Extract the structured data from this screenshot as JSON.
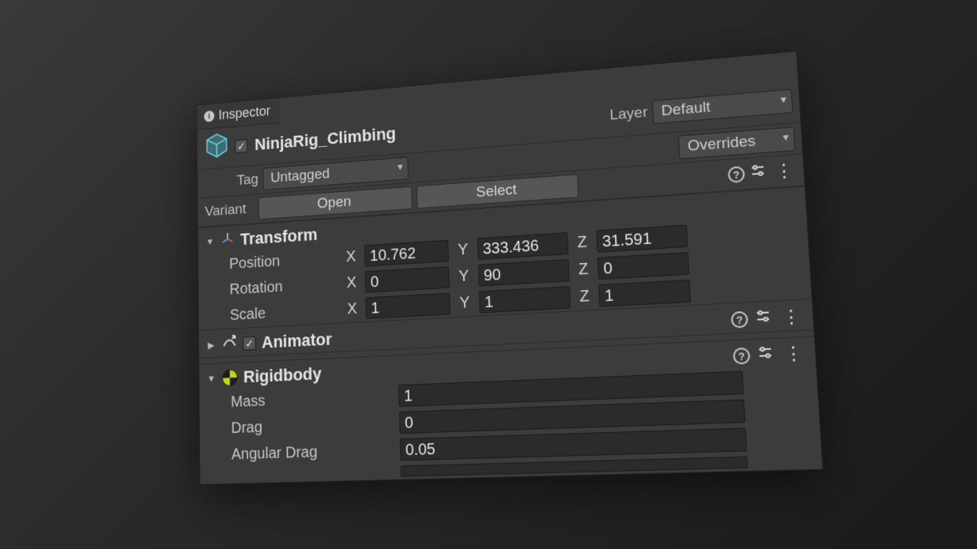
{
  "inspector": {
    "tab_label": "Inspector",
    "object": {
      "enabled_check": "✓",
      "name": "NinjaRig_Climbing"
    },
    "tag_label": "Tag",
    "tag_value": "Untagged",
    "layer_label": "Layer",
    "layer_value": "Default",
    "variant_label": "Variant",
    "open_btn": "Open",
    "select_btn": "Select",
    "overrides_btn": "Overrides"
  },
  "transform": {
    "title": "Transform",
    "position_label": "Position",
    "rotation_label": "Rotation",
    "scale_label": "Scale",
    "axis": {
      "x": "X",
      "y": "Y",
      "z": "Z"
    },
    "position": {
      "x": "10.762",
      "y": "333.436",
      "z": "31.591"
    },
    "rotation": {
      "x": "0",
      "y": "90",
      "z": "0"
    },
    "scale": {
      "x": "1",
      "y": "1",
      "z": "1"
    }
  },
  "animator": {
    "title": "Animator",
    "enabled_check": "✓"
  },
  "rigidbody": {
    "title": "Rigidbody",
    "mass_label": "Mass",
    "mass": "1",
    "drag_label": "Drag",
    "drag": "0",
    "angdrag_label": "Angular Drag",
    "angdrag": "0.05"
  }
}
